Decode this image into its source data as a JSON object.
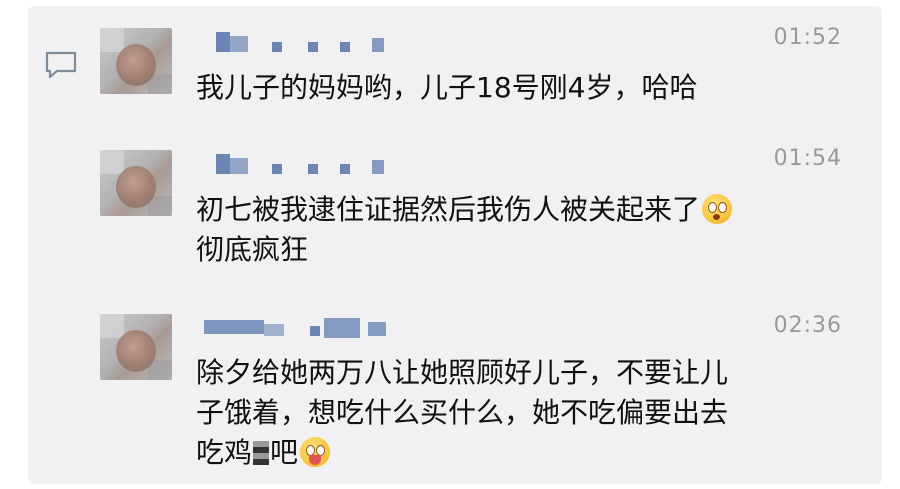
{
  "messages": [
    {
      "time": "01:52",
      "lines": [
        "我儿子的妈妈哟，儿子18号刚4岁，哈哈"
      ],
      "emoji": null
    },
    {
      "time": "01:54",
      "lines": [
        "初七被我逮住证据然后我伤人被关起来了",
        "彻底疯狂"
      ],
      "emoji": "flushed-face"
    },
    {
      "time": "02:36",
      "lines": [
        "除夕给她两万八让她照顾好儿子，不要让儿",
        "子饿着，想吃什么买什么，她不吃偏要出去",
        "吃鸡",
        "吧"
      ],
      "emoji": "tongue-out-face"
    }
  ],
  "colors": {
    "panel": "#f1f1f3",
    "text": "#111111",
    "time": "#9a9a9a",
    "name_mosaic": "#6b86b4"
  }
}
